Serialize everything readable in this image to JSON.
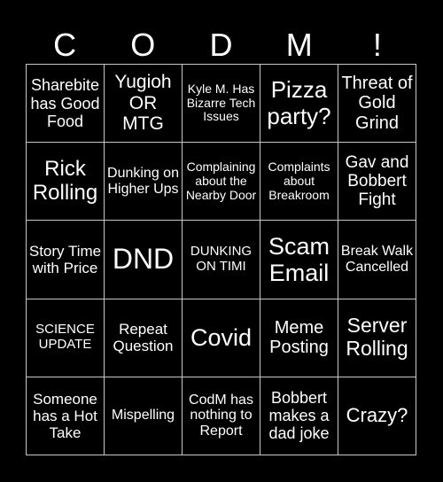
{
  "header": [
    "C",
    "O",
    "D",
    "M",
    "!"
  ],
  "cells": [
    {
      "text": "Sharebite has Good Food",
      "size": 18
    },
    {
      "text": "Yugioh OR MTG",
      "size": 21
    },
    {
      "text": "Kyle M. Has Bizarre Tech Issues",
      "size": 14
    },
    {
      "text": "Pizza party?",
      "size": 26
    },
    {
      "text": "Threat of Gold Grind",
      "size": 20
    },
    {
      "text": "Rick Rolling",
      "size": 24
    },
    {
      "text": "Dunking on Higher Ups",
      "size": 16
    },
    {
      "text": "Complaining about the Nearby Door",
      "size": 14
    },
    {
      "text": "Complaints about Breakroom",
      "size": 14
    },
    {
      "text": "Gav and Bobbert Fight",
      "size": 19
    },
    {
      "text": "Story Time with Price",
      "size": 17
    },
    {
      "text": "DND",
      "size": 32
    },
    {
      "text": "DUNKING ON TIMI",
      "size": 15
    },
    {
      "text": "Scam Email",
      "size": 27
    },
    {
      "text": "Break Walk Cancelled",
      "size": 16
    },
    {
      "text": "SCIENCE UPDATE",
      "size": 15
    },
    {
      "text": "Repeat Question",
      "size": 17
    },
    {
      "text": "Covid",
      "size": 27
    },
    {
      "text": "Meme Posting",
      "size": 20
    },
    {
      "text": "Server Rolling",
      "size": 23
    },
    {
      "text": "Someone has a Hot Take",
      "size": 17
    },
    {
      "text": "Mispelling",
      "size": 16
    },
    {
      "text": "CodM has nothing to Report",
      "size": 16
    },
    {
      "text": "Bobbert makes a dad joke",
      "size": 18
    },
    {
      "text": "Crazy?",
      "size": 22
    }
  ]
}
